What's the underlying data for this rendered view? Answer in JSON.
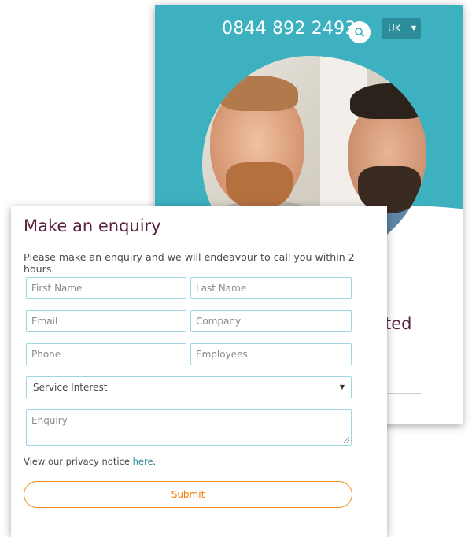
{
  "header": {
    "phone": "0844 892 2493",
    "search_icon": "search-icon",
    "region": "UK",
    "brand_color": "#3eb1c0"
  },
  "site": {
    "partial_heading": "ted"
  },
  "form": {
    "title": "Make an enquiry",
    "intro": "Please make an enquiry and we will endeavour to call you within 2 hours.",
    "fields": {
      "first_name": "First Name",
      "last_name": "Last Name",
      "email": "Email",
      "company": "Company",
      "phone": "Phone",
      "employees": "Employees",
      "service_interest": "Service Interest",
      "enquiry": "Enquiry"
    },
    "privacy_text": "View our privacy notice ",
    "privacy_link": "here",
    "privacy_end": ".",
    "submit_label": "Submit",
    "title_color": "#5a2340",
    "submit_color": "#ef7d0b"
  }
}
